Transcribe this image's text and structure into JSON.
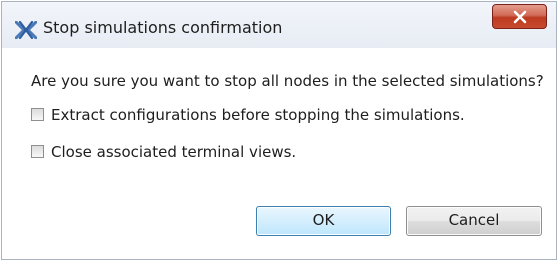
{
  "window": {
    "title": "Stop simulations confirmation",
    "app_icon": "simulation-app-icon",
    "close_icon": "close-icon"
  },
  "message": {
    "question": "Are you sure you want to stop all nodes in the selected simulations?"
  },
  "options": [
    {
      "label": "Extract configurations before stopping the simulations.",
      "checked": false
    },
    {
      "label": "Close associated terminal views.",
      "checked": false
    }
  ],
  "buttons": {
    "ok_label": "OK",
    "cancel_label": "Cancel"
  },
  "colors": {
    "close_button": "#c84a2e",
    "default_button_border": "#3c7fb1"
  }
}
